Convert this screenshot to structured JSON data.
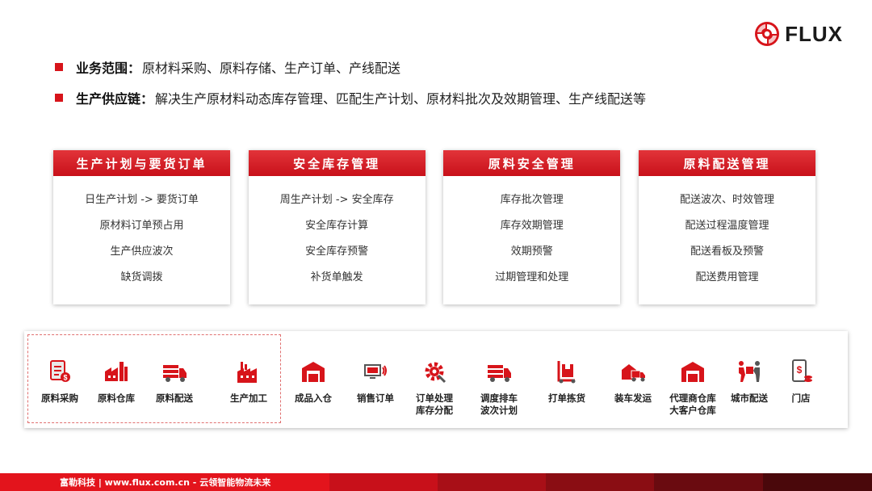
{
  "brand": {
    "name": "FLUX",
    "color": "#d7141a"
  },
  "bullets": [
    {
      "label": "业务范围",
      "colon": "：",
      "text": "原材料采购、原料存储、生产订单、产线配送"
    },
    {
      "label": "生产供应链",
      "colon": "：",
      "text": "解决生产原材料动态库存管理、匹配生产计划、原材料批次及效期管理、生产线配送等"
    }
  ],
  "cards": [
    {
      "title": "生产计划与要货订单",
      "items": [
        "日生产计划 -> 要货订单",
        "原材料订单预占用",
        "生产供应波次",
        "缺货调拨"
      ]
    },
    {
      "title": "安全库存管理",
      "items": [
        "周生产计划 -> 安全库存",
        "安全库存计算",
        "安全库存预警",
        "补货单触发"
      ]
    },
    {
      "title": "原料安全管理",
      "items": [
        "库存批次管理",
        "库存效期管理",
        "效期预警",
        "过期管理和处理"
      ]
    },
    {
      "title": "原料配送管理",
      "items": [
        "配送波次、时效管理",
        "配送过程温度管理",
        "配送看板及预警",
        "配送费用管理"
      ]
    }
  ],
  "process_steps": [
    {
      "icon": "purchase-invoice-icon",
      "line1": "原料采购",
      "line2": ""
    },
    {
      "icon": "warehouse-factory-icon",
      "line1": "原料仓库",
      "line2": ""
    },
    {
      "icon": "delivery-truck-icon",
      "line1": "原料配送",
      "line2": ""
    },
    {
      "icon": "production-factory-icon",
      "line1": "生产加工",
      "line2": ""
    },
    {
      "icon": "warehouse-inbound-icon",
      "line1": "成品入仓",
      "line2": ""
    },
    {
      "icon": "sales-monitor-icon",
      "line1": "销售订单",
      "line2": ""
    },
    {
      "icon": "gear-tools-icon",
      "line1": "订单处理",
      "line2": "库存分配"
    },
    {
      "icon": "schedule-truck-icon",
      "line1": "调度排车",
      "line2": "波次计划"
    },
    {
      "icon": "hand-truck-icon",
      "line1": "打单拣货",
      "line2": ""
    },
    {
      "icon": "loading-truck-icon",
      "line1": "装车发运",
      "line2": ""
    },
    {
      "icon": "agent-warehouse-icon",
      "line1": "代理商仓库",
      "line2": "大客户仓库"
    },
    {
      "icon": "courier-delivery-icon",
      "line1": "城市配送",
      "line2": ""
    },
    {
      "icon": "store-payment-icon",
      "line1": "门店",
      "line2": ""
    }
  ],
  "footer": {
    "text": "富勒科技 | www.flux.com.cn - 云领智能物流未来"
  }
}
